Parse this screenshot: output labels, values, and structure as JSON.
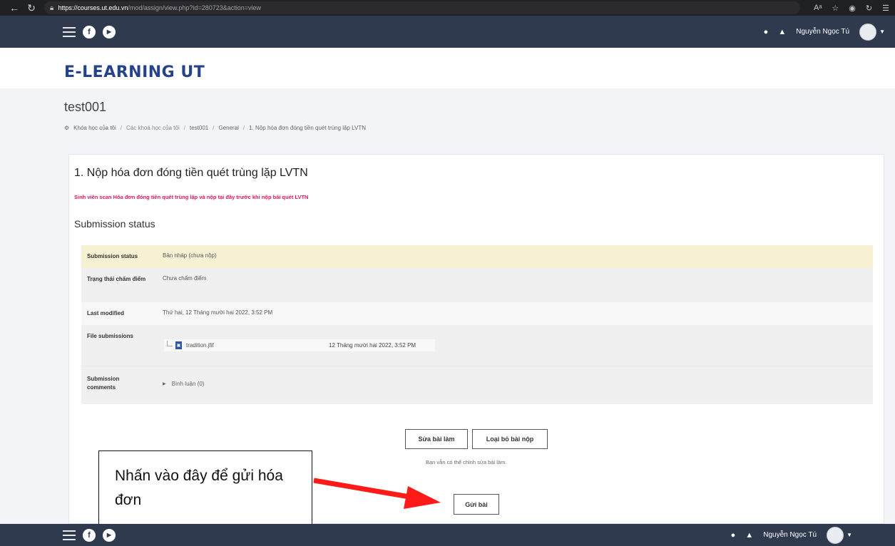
{
  "browser": {
    "url_host": "https://courses.ut.edu.vn",
    "url_path": "/mod/assign/view.php?id=280723&action=view"
  },
  "topnav": {
    "social1": "f",
    "social2": "▶",
    "user_name": "Nguyễn Ngọc Tú"
  },
  "logo": "E-LEARNING UT",
  "course": {
    "title": "test001",
    "breadcrumb": [
      "Khóa học của tôi",
      "Các khoá học của tôi",
      "test001",
      "General",
      "1. Nộp hóa đơn đóng tiền quét trùng lặp LVTN"
    ]
  },
  "assignment": {
    "title": "1. Nộp hóa đơn đóng tiền quét trùng lặp LVTN",
    "description": "Sinh viên scan Hóa đơn đóng tiền quét trùng lặp và nộp tại đây trước khi nộp bài quét LVTN",
    "status_heading": "Submission status"
  },
  "status_table": {
    "rows": [
      {
        "label": "Submission status",
        "value": "Bản nháp (chưa nộp)"
      },
      {
        "label": "Trạng thái chấm điểm",
        "value": "Chưa chấm điểm"
      },
      {
        "label": "Last modified",
        "value": "Thứ hai, 12 Tháng mười hai 2022, 3:52 PM"
      },
      {
        "label": "File submissions",
        "file_name": "tradition.jfif",
        "file_date": "12 Tháng mười hai 2022, 3:52 PM"
      },
      {
        "label": "Submission comments",
        "value": "Bình luận (0)"
      }
    ]
  },
  "actions": {
    "edit_label": "Sửa bài làm",
    "remove_label": "Loại bỏ bài nộp",
    "hint": "Bạn vẫn có thể chỉnh sửa bài làm.",
    "submit_label": "Gửi bài"
  },
  "annotation": {
    "text": "Nhấn vào đây để gửi hóa đơn",
    "arrow_color": "#ff1a1a"
  },
  "colors": {
    "nav_bg": "#2f3a4f",
    "logo": "#24438a",
    "description": "#e8144d",
    "status_highlight": "#f6f1d3"
  }
}
